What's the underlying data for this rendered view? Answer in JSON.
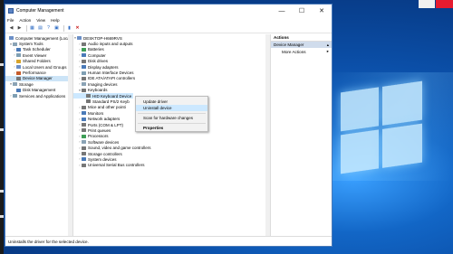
{
  "window": {
    "title": "Computer Management",
    "controls": {
      "minimize": "—",
      "maximize": "☐",
      "close": "✕"
    }
  },
  "menu": [
    "File",
    "Action",
    "View",
    "Help"
  ],
  "left_tree": [
    {
      "label": "Computer Management (Local",
      "indent": 0,
      "icon": "computer-management-icon"
    },
    {
      "label": "System Tools",
      "indent": 1,
      "icon": "toolbox-icon"
    },
    {
      "label": "Task Scheduler",
      "indent": 2,
      "icon": "clock-icon"
    },
    {
      "label": "Event Viewer",
      "indent": 2,
      "icon": "event-icon"
    },
    {
      "label": "Shared Folders",
      "indent": 2,
      "icon": "folder-icon"
    },
    {
      "label": "Local Users and Groups",
      "indent": 2,
      "icon": "users-icon"
    },
    {
      "label": "Performance",
      "indent": 2,
      "icon": "performance-icon"
    },
    {
      "label": "Device Manager",
      "indent": 2,
      "icon": "device-manager-icon",
      "selected": true
    },
    {
      "label": "Storage",
      "indent": 1,
      "icon": "storage-icon"
    },
    {
      "label": "Disk Management",
      "indent": 2,
      "icon": "disk-icon"
    },
    {
      "label": "Services and Applications",
      "indent": 1,
      "icon": "services-icon"
    }
  ],
  "device_tree": [
    {
      "label": "DESKTOP-H669RVS",
      "indent": 0,
      "icon": "computer-icon"
    },
    {
      "label": "Audio inputs and outputs",
      "indent": 1
    },
    {
      "label": "Batteries",
      "indent": 1
    },
    {
      "label": "Computer",
      "indent": 1
    },
    {
      "label": "Disk drives",
      "indent": 1
    },
    {
      "label": "Display adapters",
      "indent": 1
    },
    {
      "label": "Human Interface Devices",
      "indent": 1
    },
    {
      "label": "IDE ATA/ATAPI controllers",
      "indent": 1
    },
    {
      "label": "Imaging devices",
      "indent": 1
    },
    {
      "label": "Keyboards",
      "indent": 1,
      "expanded": true
    },
    {
      "label": "HID Keyboard Device",
      "indent": 2,
      "highlighted": true
    },
    {
      "label": "Standard PS/2 Keyb",
      "indent": 2
    },
    {
      "label": "Mice and other pointi",
      "indent": 1
    },
    {
      "label": "Monitors",
      "indent": 1
    },
    {
      "label": "Network adapters",
      "indent": 1
    },
    {
      "label": "Ports (COM & LPT)",
      "indent": 1
    },
    {
      "label": "Print queues",
      "indent": 1
    },
    {
      "label": "Processors",
      "indent": 1
    },
    {
      "label": "Software devices",
      "indent": 1
    },
    {
      "label": "Sound, video and game controllers",
      "indent": 1
    },
    {
      "label": "Storage controllers",
      "indent": 1
    },
    {
      "label": "System devices",
      "indent": 1
    },
    {
      "label": "Universal Serial Bus controllers",
      "indent": 1
    }
  ],
  "context_menu": {
    "update_driver": "Update driver",
    "uninstall_device": "Uninstall device",
    "scan_hardware": "Scan for hardware changes",
    "properties": "Properties"
  },
  "actions": {
    "header": "Actions",
    "section": "Device Manager",
    "more": "More Actions"
  },
  "status": "Uninstalls the driver for the selected device."
}
